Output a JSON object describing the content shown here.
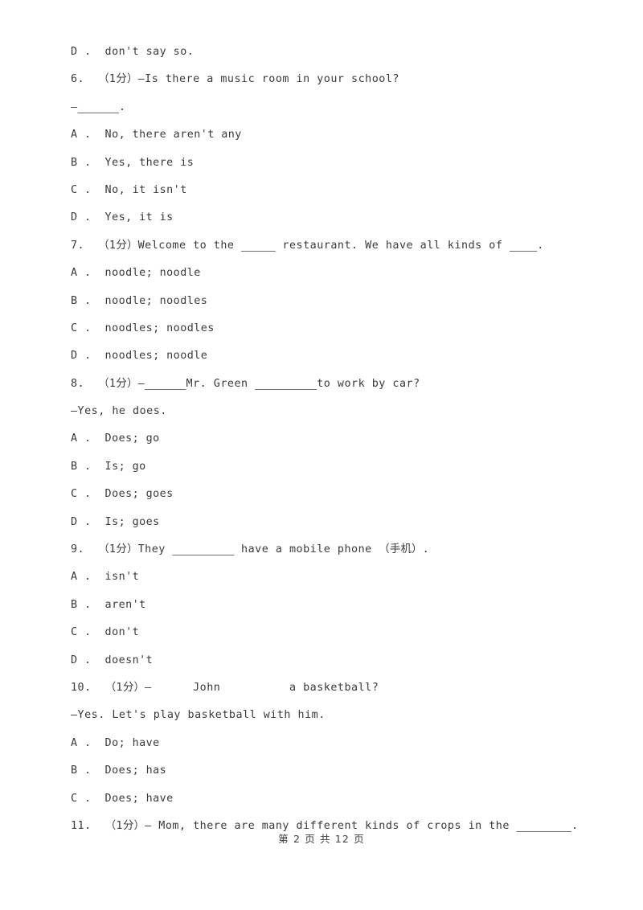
{
  "document": {
    "type": "exam-worksheet",
    "language": "zh-CN",
    "text_color": "#3a3a3a",
    "background_color": "#ffffff"
  },
  "lines": [
    {
      "id": "l1",
      "kind": "option",
      "text": "D .  don't say so."
    },
    {
      "id": "l2",
      "kind": "question",
      "text": "6.  （1分）—Is there a music room in your school?"
    },
    {
      "id": "l3",
      "kind": "answer",
      "prefix": "—",
      "blank": "______",
      "suffix": "."
    },
    {
      "id": "l4",
      "kind": "option",
      "text": "A .  No, there aren't any"
    },
    {
      "id": "l5",
      "kind": "option",
      "text": "B .  Yes, there is"
    },
    {
      "id": "l6",
      "kind": "option",
      "text": "C .  No, it isn't"
    },
    {
      "id": "l7",
      "kind": "option",
      "text": "D .  Yes, it is"
    },
    {
      "id": "l8",
      "kind": "question",
      "segments": [
        {
          "t": "text",
          "v": "7.  （1分）Welcome to the "
        },
        {
          "t": "blank",
          "v": "_____"
        },
        {
          "t": "text",
          "v": " restaurant. We have all kinds of "
        },
        {
          "t": "blank",
          "v": "____"
        },
        {
          "t": "text",
          "v": "."
        }
      ]
    },
    {
      "id": "l9",
      "kind": "option",
      "text": "A .  noodle; noodle"
    },
    {
      "id": "l10",
      "kind": "option",
      "text": "B .  noodle; noodles"
    },
    {
      "id": "l11",
      "kind": "option",
      "text": "C .  noodles; noodles"
    },
    {
      "id": "l12",
      "kind": "option",
      "text": "D .  noodles; noodle"
    },
    {
      "id": "l13",
      "kind": "question",
      "segments": [
        {
          "t": "text",
          "v": "8.  （1分）—"
        },
        {
          "t": "blank",
          "v": "______"
        },
        {
          "t": "text",
          "v": "Mr. Green "
        },
        {
          "t": "blank",
          "v": "_________"
        },
        {
          "t": "text",
          "v": "to work by car?"
        }
      ]
    },
    {
      "id": "l14",
      "kind": "answer",
      "text": "—Yes, he does."
    },
    {
      "id": "l15",
      "kind": "option",
      "text": "A .  Does; go"
    },
    {
      "id": "l16",
      "kind": "option",
      "text": "B .  Is; go"
    },
    {
      "id": "l17",
      "kind": "option",
      "text": "C .  Does; goes"
    },
    {
      "id": "l18",
      "kind": "option",
      "text": "D .  Is; goes"
    },
    {
      "id": "l19",
      "kind": "question",
      "segments": [
        {
          "t": "text",
          "v": "9.  （1分）They "
        },
        {
          "t": "blank",
          "v": "_________"
        },
        {
          "t": "text",
          "v": " have a mobile phone （手机）."
        }
      ]
    },
    {
      "id": "l20",
      "kind": "option",
      "text": "A .  isn't"
    },
    {
      "id": "l21",
      "kind": "option",
      "text": "B .  aren't"
    },
    {
      "id": "l22",
      "kind": "option",
      "text": "C .  don't"
    },
    {
      "id": "l23",
      "kind": "option",
      "text": "D .  doesn't"
    },
    {
      "id": "l24",
      "kind": "question",
      "segments": [
        {
          "t": "text",
          "v": "10.  （1分）—"
        },
        {
          "t": "gap",
          "v": "      "
        },
        {
          "t": "text",
          "v": "John"
        },
        {
          "t": "gap",
          "v": "          "
        },
        {
          "t": "text",
          "v": "a basketball?"
        }
      ]
    },
    {
      "id": "l25",
      "kind": "answer",
      "text": "—Yes. Let's play basketball with him."
    },
    {
      "id": "l26",
      "kind": "option",
      "text": "A .  Do; have"
    },
    {
      "id": "l27",
      "kind": "option",
      "text": "B .  Does; has"
    },
    {
      "id": "l28",
      "kind": "option",
      "text": "C .  Does; have"
    },
    {
      "id": "l29",
      "kind": "question",
      "segments": [
        {
          "t": "text",
          "v": "11.  （1分）— Mom, there are many different kinds of crops in the "
        },
        {
          "t": "blank",
          "v": "________"
        },
        {
          "t": "text",
          "v": "."
        }
      ]
    }
  ],
  "footer": {
    "text": "第 2 页 共 12 页",
    "current_page": "2",
    "total_pages": "12"
  }
}
